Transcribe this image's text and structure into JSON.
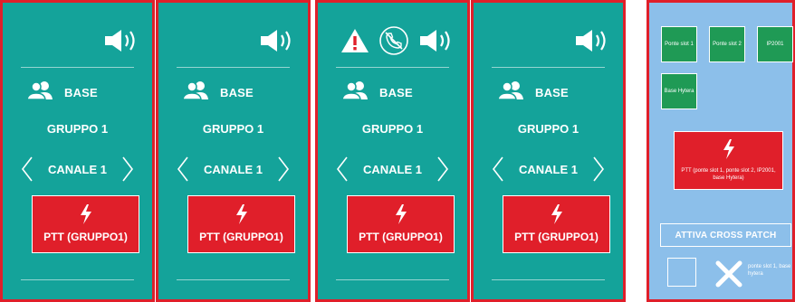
{
  "colors": {
    "panel_bg": "#14a39a",
    "panel_border": "#e01f2a",
    "ptt_bg": "#e01f2a",
    "crosspatch_bg": "#8cbfea",
    "slot_bg": "#1f9a55",
    "warning": "#e01f2a"
  },
  "panels": [
    {
      "icons": [
        "speaker-icon"
      ],
      "base": "BASE",
      "group": "GRUPPO 1",
      "channel": "CANALE 1",
      "ptt": "PTT (GRUPPO1)"
    },
    {
      "icons": [
        "speaker-icon"
      ],
      "base": "BASE",
      "group": "GRUPPO 1",
      "channel": "CANALE 1",
      "ptt": "PTT (GRUPPO1)"
    },
    {
      "icons": [
        "warning-icon",
        "phone-off-icon",
        "speaker-icon"
      ],
      "base": "BASE",
      "group": "GRUPPO 1",
      "channel": "CANALE 1",
      "ptt": "PTT (GRUPPO1)"
    },
    {
      "icons": [
        "speaker-icon"
      ],
      "base": "BASE",
      "group": "GRUPPO 1",
      "channel": "CANALE 1",
      "ptt": "PTT (GRUPPO1)"
    }
  ],
  "crosspatch": {
    "slots": [
      "Ponte slot 1",
      "Ponte slot 2",
      "IP2001",
      "Base Hytera"
    ],
    "ptt_label": "PTT (ponte slot 1, ponte slot 2, IP2001, base Hytera)",
    "activate_label": "ATTIVA CROSS PATCH",
    "note": "ponte slot 1, base hytera"
  }
}
